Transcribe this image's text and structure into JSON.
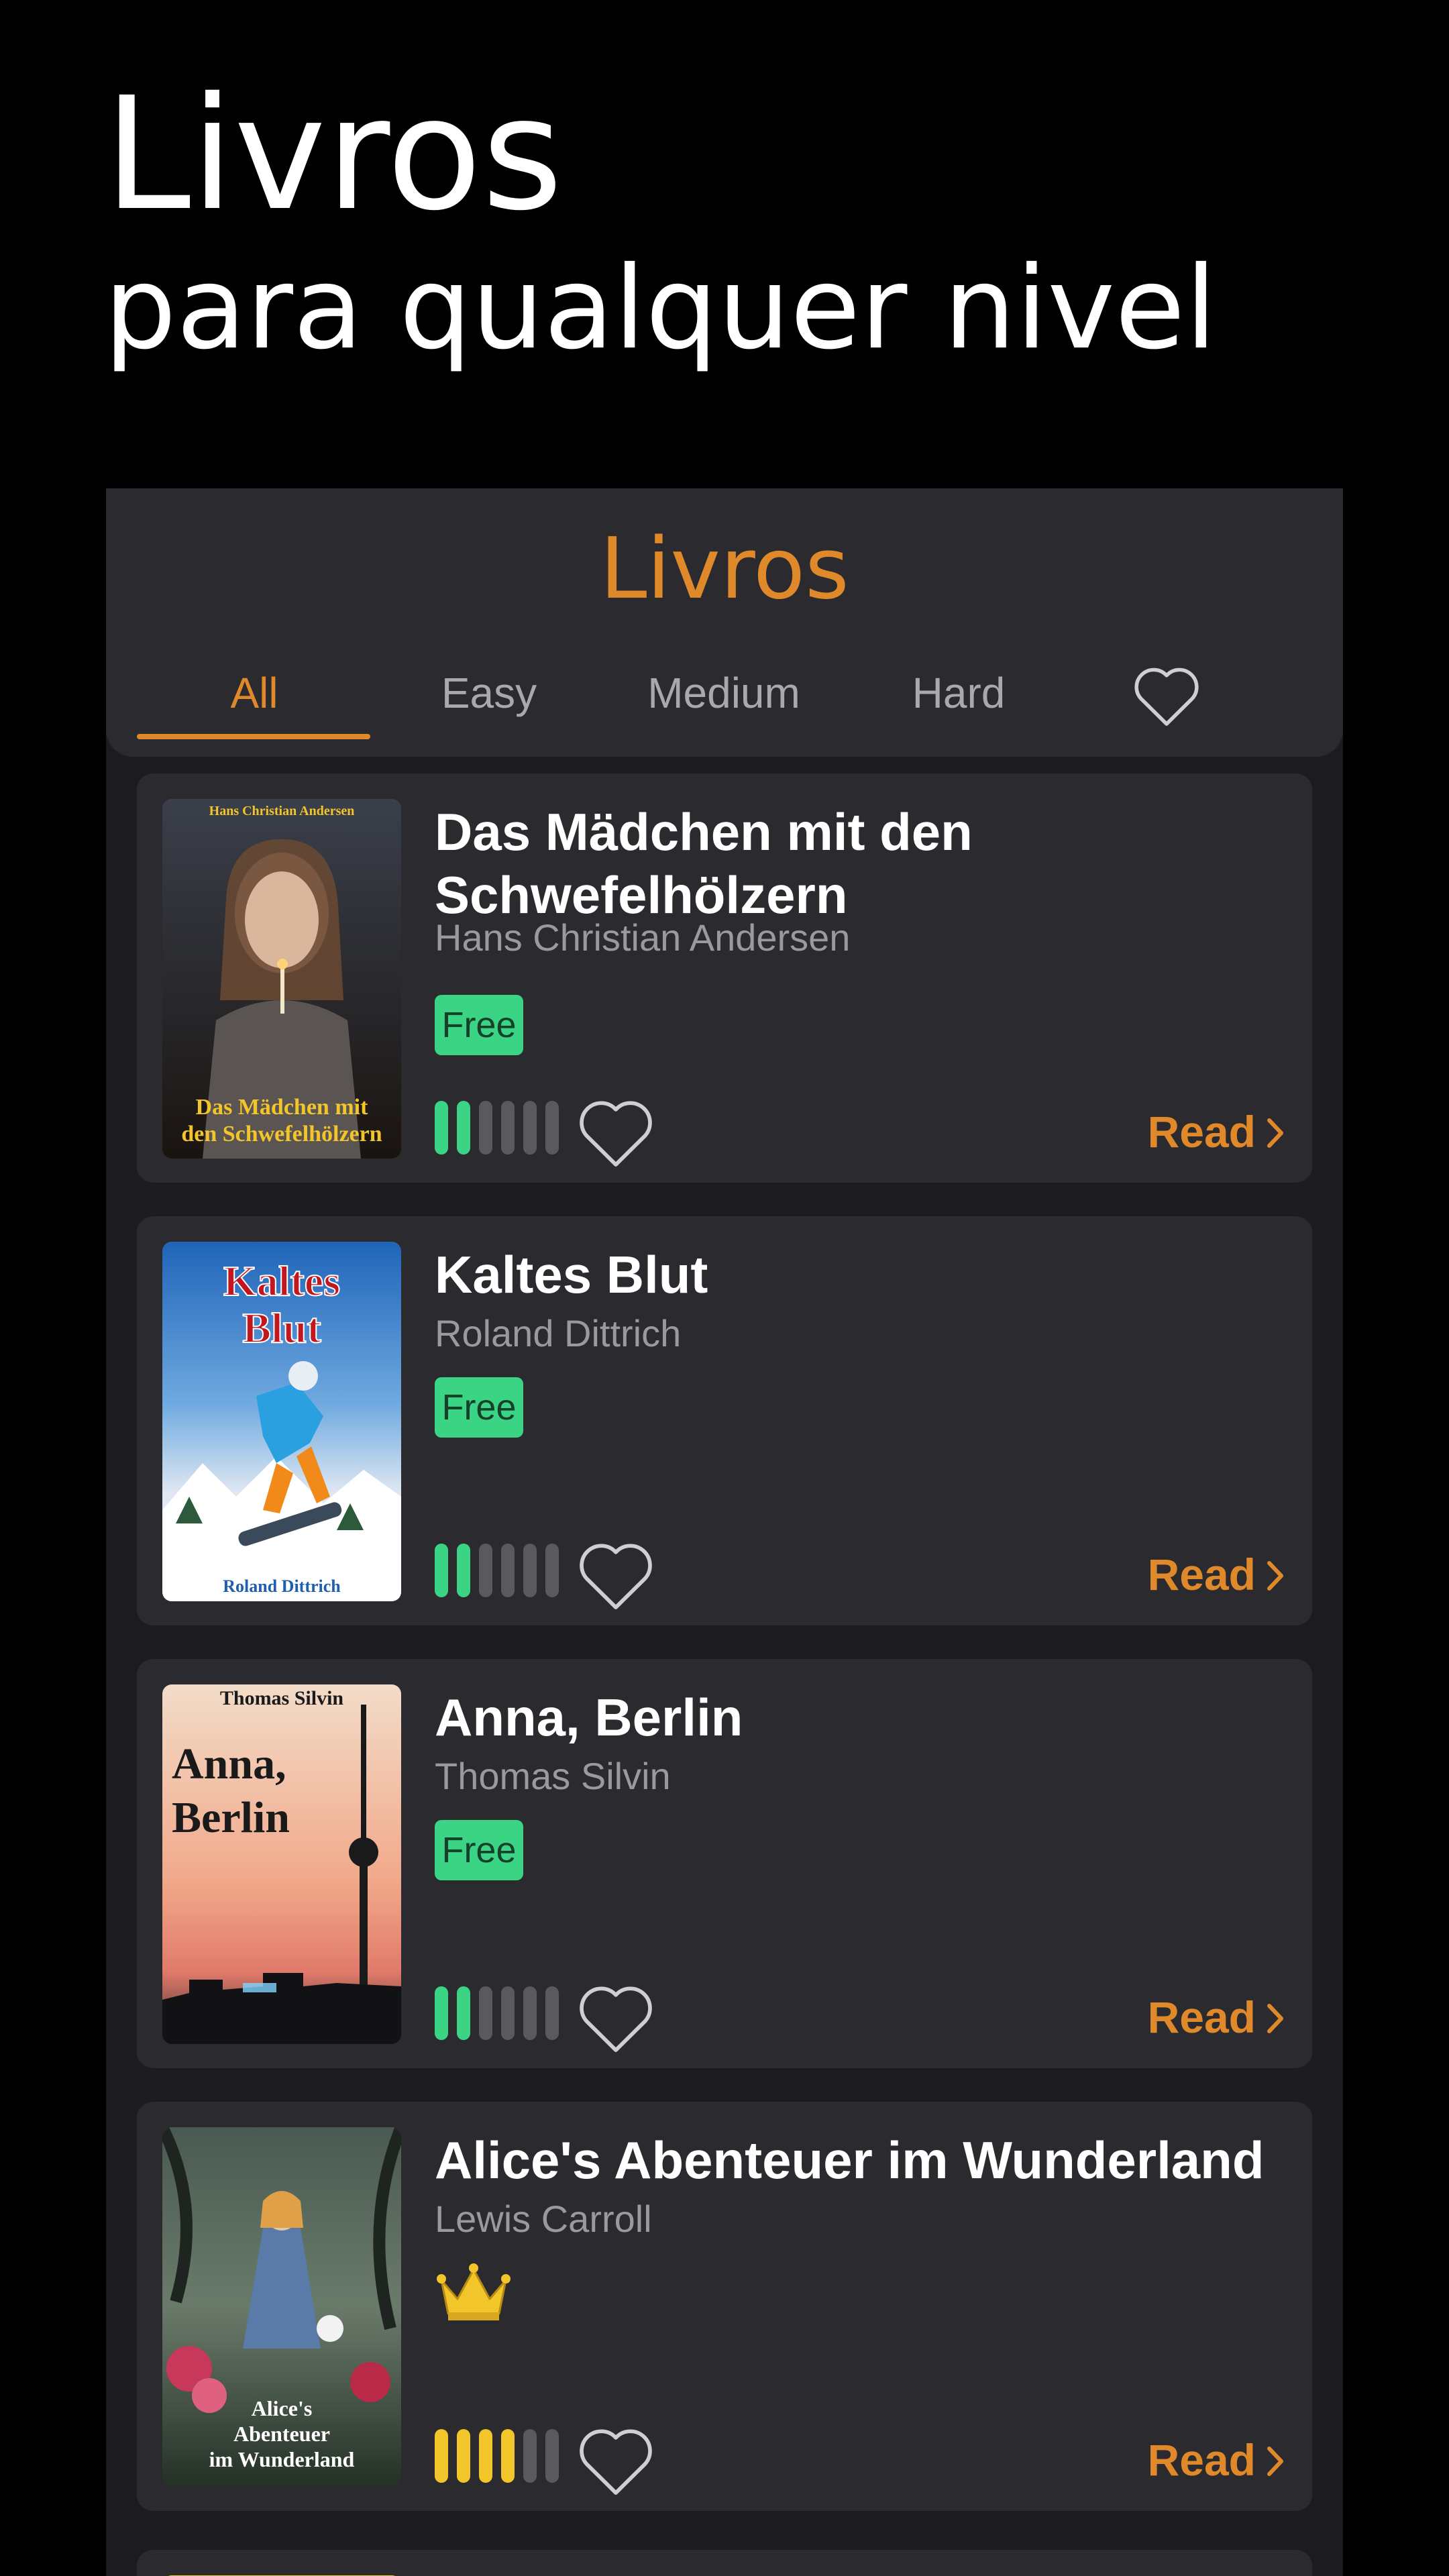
{
  "promo": {
    "line1": "Livros",
    "line2": "para qualquer nivel"
  },
  "header": {
    "title": "Livros",
    "tabs": [
      {
        "label": "All",
        "active": true
      },
      {
        "label": "Easy",
        "active": false
      },
      {
        "label": "Medium",
        "active": false
      },
      {
        "label": "Hard",
        "active": false
      }
    ],
    "favorites_icon": "heart-outline-icon"
  },
  "colors": {
    "accent": "#e0892a",
    "free_badge": "#3ad484",
    "level_easy": "#3ad484",
    "level_hard": "#f2c52a",
    "level_empty": "#5a5a5e",
    "card": "#2b2b2f",
    "background": "#1c1c1e"
  },
  "books": [
    {
      "title": "Das Mädchen mit den Schwefelhölzern",
      "author": "Hans Christian Andersen",
      "access": "Free",
      "level": 2,
      "level_max": 6,
      "read_label": "Read",
      "cover_text_top": "Hans Christian Andersen",
      "cover_text_bottom": "Das Mädchen mit den Schwefelhölzern"
    },
    {
      "title": "Kaltes Blut",
      "author": "Roland Dittrich",
      "access": "Free",
      "level": 2,
      "level_max": 6,
      "read_label": "Read",
      "cover_text_top": "Kaltes Blut",
      "cover_text_bottom": "Roland Dittrich"
    },
    {
      "title": "Anna, Berlin",
      "author": "Thomas Silvin",
      "access": "Free",
      "level": 2,
      "level_max": 6,
      "read_label": "Read",
      "cover_text_top": "Thomas Silvin",
      "cover_text_bottom": "Anna, Berlin"
    },
    {
      "title": "Alice's Abenteuer im Wunderland",
      "author": "Lewis Carroll",
      "access": "premium",
      "access_icon": "crown-icon",
      "level": 4,
      "level_max": 6,
      "read_label": "Read",
      "cover_text_bottom": "Alice's Abenteuer im Wunderland"
    }
  ]
}
